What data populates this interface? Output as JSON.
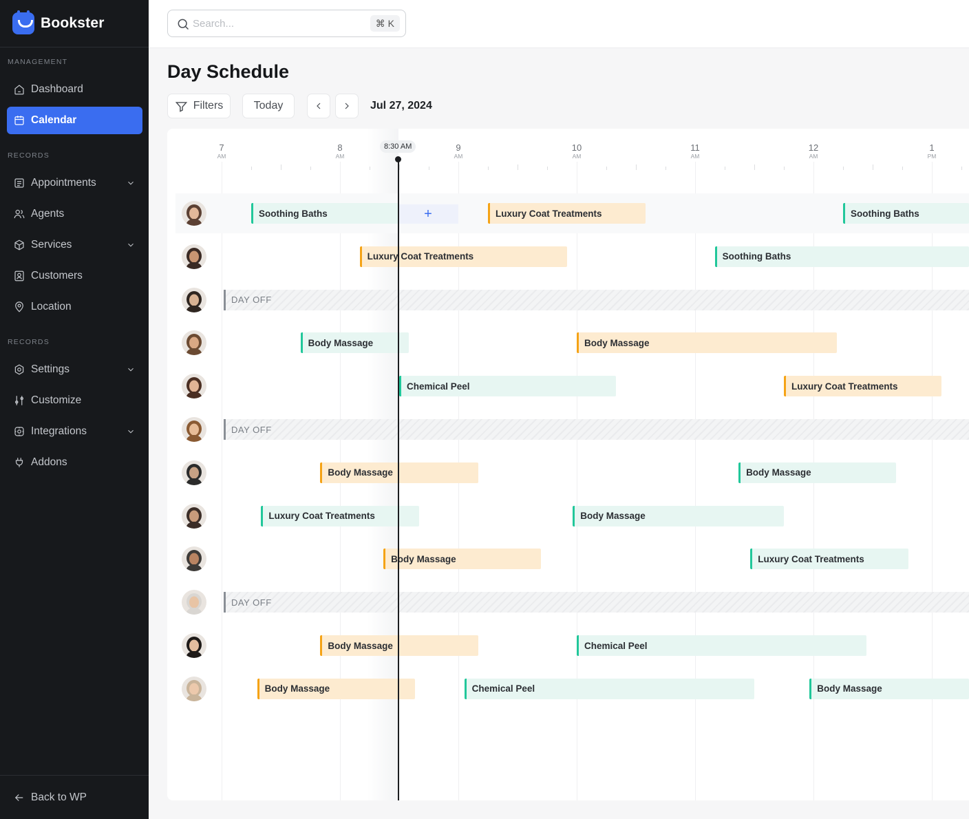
{
  "brand": {
    "name": "Bookster"
  },
  "sidebar": {
    "sections": [
      "MANAGEMENT",
      "RECORDS",
      "RECORDS"
    ],
    "items": [
      {
        "label": "Dashboard",
        "icon": "home-icon"
      },
      {
        "label": "Calendar",
        "icon": "calendar-icon",
        "active": true
      },
      {
        "label": "Appointments",
        "icon": "list-icon",
        "has_children": true
      },
      {
        "label": "Agents",
        "icon": "users-icon"
      },
      {
        "label": "Services",
        "icon": "box-icon",
        "has_children": true
      },
      {
        "label": "Customers",
        "icon": "user-card-icon"
      },
      {
        "label": "Location",
        "icon": "pin-icon"
      },
      {
        "label": "Settings",
        "icon": "gear-icon",
        "has_children": true
      },
      {
        "label": "Customize",
        "icon": "sliders-icon"
      },
      {
        "label": "Integrations",
        "icon": "integration-icon",
        "has_children": true
      },
      {
        "label": "Addons",
        "icon": "plug-icon"
      }
    ],
    "back_label": "Back to WP"
  },
  "search": {
    "placeholder": "Search...",
    "shortcut": "⌘ K"
  },
  "page": {
    "title": "Day Schedule",
    "filters_label": "Filters",
    "today_label": "Today",
    "date": "Jul 27, 2024"
  },
  "timeline": {
    "hours": [
      {
        "h": "7",
        "ap": "AM"
      },
      {
        "h": "8",
        "ap": "AM"
      },
      {
        "h": "9",
        "ap": "AM"
      },
      {
        "h": "10",
        "ap": "AM"
      },
      {
        "h": "11",
        "ap": "AM"
      },
      {
        "h": "12",
        "ap": "AM"
      },
      {
        "h": "1",
        "ap": "PM"
      }
    ],
    "now_label": "8:30 AM",
    "add_symbol": "+",
    "day_off_label": "DAY OFF",
    "colors": {
      "teal": "#21c79a",
      "orange": "#f5a316",
      "accent": "#3a6df0"
    },
    "rows": [
      {
        "avatar": "avatar-woman-1",
        "appointments": [
          {
            "label": "Soothing Baths",
            "color": "teal",
            "start": "7:15",
            "end": "8:30"
          },
          {
            "label": "Luxury Coat Treatments",
            "color": "orange",
            "start": "9:15",
            "end": "10:35"
          },
          {
            "label": "Soothing Baths",
            "color": "teal",
            "start": "12:15",
            "end": "13:35"
          }
        ]
      },
      {
        "avatar": "avatar-woman-2",
        "appointments": [
          {
            "label": "Luxury Coat Treatments",
            "color": "orange",
            "start": "8:10",
            "end": "9:55"
          },
          {
            "label": "Soothing Baths",
            "color": "teal",
            "start": "11:10",
            "end": "13:20"
          }
        ]
      },
      {
        "avatar": "avatar-woman-3",
        "day_off": true
      },
      {
        "avatar": "avatar-man-1",
        "appointments": [
          {
            "label": "Body Massage",
            "color": "teal",
            "start": "7:40",
            "end": "8:35"
          },
          {
            "label": "Body Massage",
            "color": "orange",
            "start": "10:00",
            "end": "12:12"
          }
        ]
      },
      {
        "avatar": "avatar-woman-4",
        "appointments": [
          {
            "label": "Chemical Peel",
            "color": "teal",
            "start": "8:30",
            "end": "10:20"
          },
          {
            "label": "Luxury Coat Treatments",
            "color": "orange",
            "start": "11:45",
            "end": "13:05"
          }
        ]
      },
      {
        "avatar": "avatar-woman-5",
        "day_off": true
      },
      {
        "avatar": "avatar-man-2",
        "appointments": [
          {
            "label": "Body Massage",
            "color": "orange",
            "start": "7:50",
            "end": "9:10"
          },
          {
            "label": "Body Massage",
            "color": "teal",
            "start": "11:22",
            "end": "12:42"
          }
        ]
      },
      {
        "avatar": "avatar-woman-6",
        "appointments": [
          {
            "label": "Luxury Coat Treatments",
            "color": "teal",
            "start": "7:20",
            "end": "8:40"
          },
          {
            "label": "Body Massage",
            "color": "teal",
            "start": "9:58",
            "end": "11:45"
          }
        ]
      },
      {
        "avatar": "avatar-man-3",
        "appointments": [
          {
            "label": "Body Massage",
            "color": "orange",
            "start": "8:22",
            "end": "9:42"
          },
          {
            "label": "Luxury Coat Treatments",
            "color": "teal",
            "start": "11:28",
            "end": "12:48"
          }
        ]
      },
      {
        "avatar": "avatar-woman-7",
        "day_off": true
      },
      {
        "avatar": "avatar-woman-8",
        "appointments": [
          {
            "label": "Body Massage",
            "color": "orange",
            "start": "7:50",
            "end": "9:10"
          },
          {
            "label": "Chemical Peel",
            "color": "teal",
            "start": "10:00",
            "end": "12:27"
          }
        ]
      },
      {
        "avatar": "avatar-woman-9",
        "appointments": [
          {
            "label": "Body Massage",
            "color": "orange",
            "start": "7:18",
            "end": "8:38"
          },
          {
            "label": "Chemical Peel",
            "color": "teal",
            "start": "9:03",
            "end": "11:30"
          },
          {
            "label": "Body Massage",
            "color": "teal",
            "start": "11:58",
            "end": "13:35"
          }
        ]
      }
    ]
  }
}
